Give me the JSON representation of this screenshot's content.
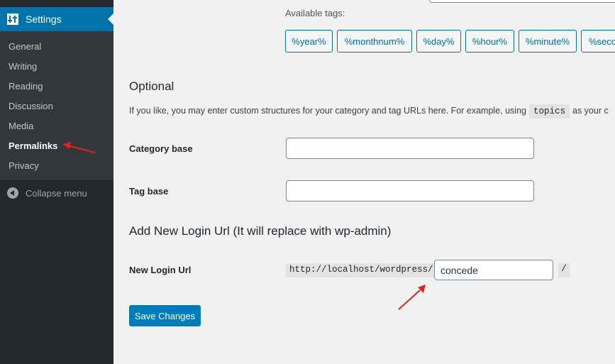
{
  "sidebar": {
    "menu_title": "Settings",
    "items": [
      {
        "label": "General",
        "current": false
      },
      {
        "label": "Writing",
        "current": false
      },
      {
        "label": "Reading",
        "current": false
      },
      {
        "label": "Discussion",
        "current": false
      },
      {
        "label": "Media",
        "current": false
      },
      {
        "label": "Permalinks",
        "current": true
      },
      {
        "label": "Privacy",
        "current": false
      }
    ],
    "collapse_label": "Collapse menu"
  },
  "tags": {
    "label": "Available tags:",
    "items": [
      "%year%",
      "%monthnum%",
      "%day%",
      "%hour%",
      "%minute%",
      "%seco"
    ]
  },
  "optional": {
    "title": "Optional",
    "desc_prefix": "If you like, you may enter custom structures for your category and tag URLs here. For example, using",
    "desc_code": "topics",
    "desc_suffix": "as your c",
    "category_label": "Category base",
    "category_value": "",
    "tag_label": "Tag base",
    "tag_value": ""
  },
  "login": {
    "title": "Add New Login Url (It will replace with wp-admin)",
    "label": "New Login Url",
    "prefix": "http://localhost/wordpress/",
    "value": "concede",
    "suffix": "/"
  },
  "save_label": "Save Changes",
  "colors": {
    "admin_bar": "#23282d",
    "submenu_bg": "#32373c",
    "accent": "#0073aa",
    "button": "#007cba",
    "annotation": "#e2231a"
  }
}
